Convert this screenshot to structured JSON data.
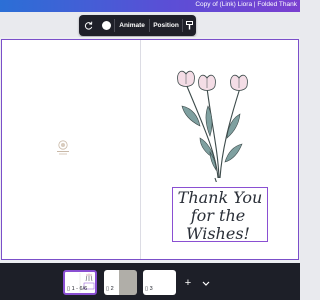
{
  "header": {
    "document_title": "Copy of (Link) Liora | Folded Thank"
  },
  "toolbar": {
    "animate_label": "Animate",
    "position_label": "Position"
  },
  "card": {
    "message_lines": [
      "Thank You",
      "for the",
      "Wishes!"
    ]
  },
  "pages": [
    {
      "label": "1 - 6/6"
    },
    {
      "label": "2"
    },
    {
      "label": "3"
    }
  ],
  "icons": [
    "rotate-icon",
    "color-swatch-icon",
    "format-paint-icon",
    "add-page-icon",
    "chevron-down-icon",
    "page-icon"
  ],
  "colors": {
    "accent": "#7b4fc9",
    "toolbar_bg": "#1f2029",
    "selection": "#8a4fd2"
  }
}
